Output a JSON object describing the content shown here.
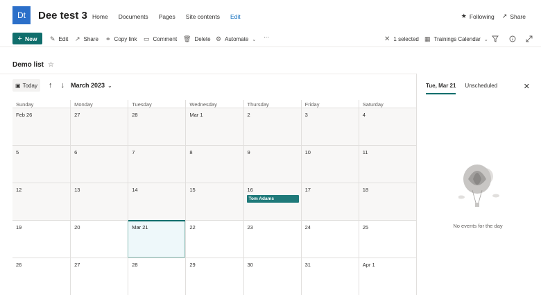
{
  "site": {
    "logo_text": "Dt",
    "title": "Dee test 3",
    "nav": [
      "Home",
      "Documents",
      "Pages",
      "Site contents"
    ],
    "nav_edit": "Edit",
    "following_label": "Following",
    "share_label": "Share",
    "brand_color": "#2b6fc9"
  },
  "commandbar": {
    "new_label": "New",
    "edit_label": "Edit",
    "share_label": "Share",
    "copy_link_label": "Copy link",
    "comment_label": "Comment",
    "delete_label": "Delete",
    "automate_label": "Automate",
    "more_label": "···",
    "selected_label": "1 selected",
    "view_label": "Trainings Calendar",
    "accent_color": "#106e6c"
  },
  "list": {
    "title": "Demo list"
  },
  "calendar": {
    "today_label": "Today",
    "month_label": "March 2023",
    "day_headers": [
      "Sunday",
      "Monday",
      "Tuesday",
      "Wednesday",
      "Thursday",
      "Friday",
      "Saturday"
    ],
    "weeks": [
      [
        "Feb 26",
        "27",
        "28",
        "Mar 1",
        "2",
        "3",
        "4"
      ],
      [
        "5",
        "6",
        "7",
        "8",
        "9",
        "10",
        "11"
      ],
      [
        "12",
        "13",
        "14",
        "15",
        "16",
        "17",
        "18"
      ],
      [
        "19",
        "20",
        "Mar 21",
        "22",
        "23",
        "24",
        "25"
      ],
      [
        "26",
        "27",
        "28",
        "29",
        "30",
        "31",
        "Apr 1"
      ]
    ],
    "event": {
      "title": "Tom Adams",
      "color": "#1f7a7a"
    }
  },
  "panel": {
    "tab_selected_day": "Tue, Mar 21",
    "tab_unscheduled": "Unscheduled",
    "empty_message": "No events for the day"
  }
}
